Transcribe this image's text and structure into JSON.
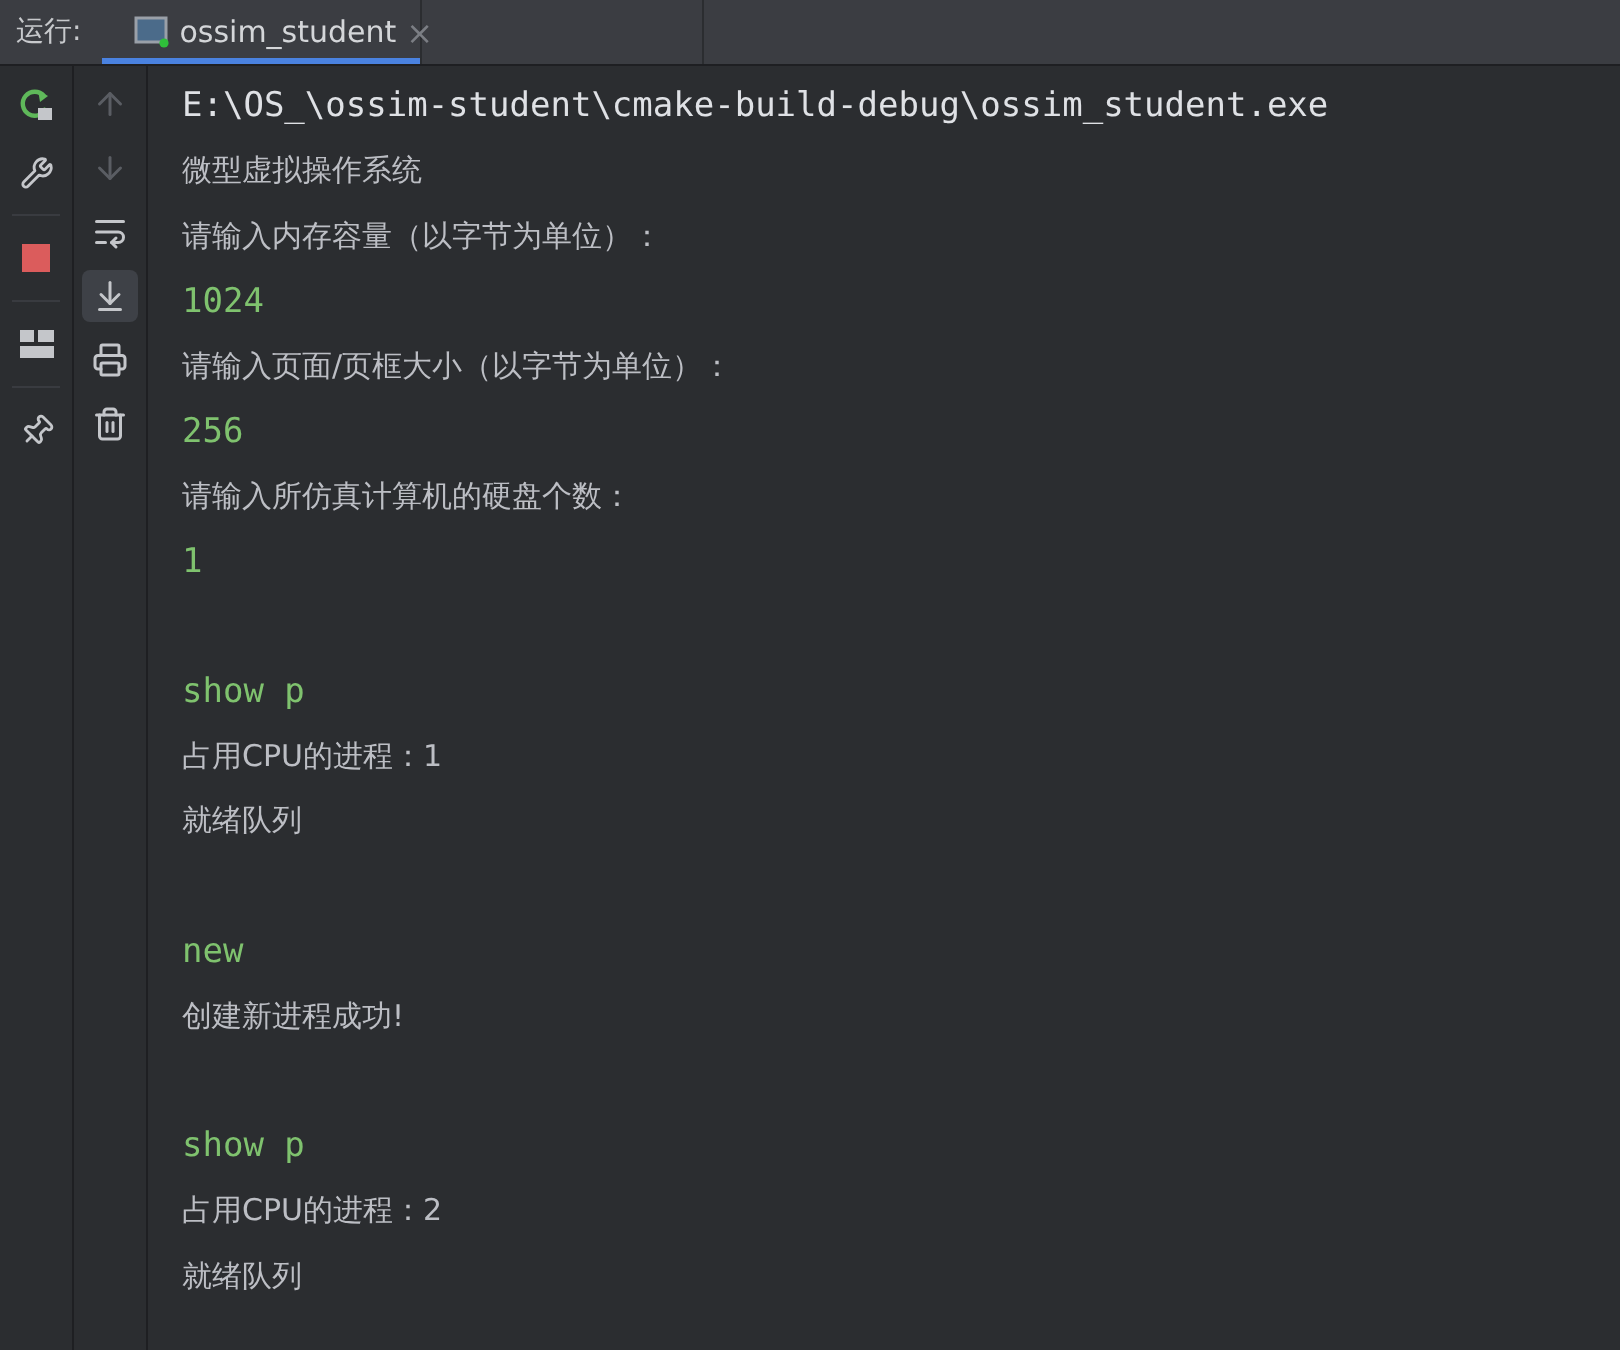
{
  "run_bar": {
    "label": "运行:",
    "tabs": [
      {
        "title": "ossim_student",
        "close": "×",
        "selected": true
      }
    ]
  },
  "left_toolbar": [
    {
      "kind": "rerun"
    },
    {
      "kind": "wrench"
    },
    {
      "kind": "stop"
    },
    {
      "kind": "layout"
    },
    {
      "kind": "pin"
    }
  ],
  "console_toolbar": [
    {
      "kind": "up",
      "disabled": true,
      "selected": false
    },
    {
      "kind": "down",
      "disabled": true,
      "selected": false
    },
    {
      "kind": "wrap",
      "disabled": false,
      "selected": false
    },
    {
      "kind": "scroll-end",
      "disabled": false,
      "selected": true
    },
    {
      "kind": "print",
      "disabled": false,
      "selected": false
    },
    {
      "kind": "trash",
      "disabled": false,
      "selected": false
    }
  ],
  "console_lines": [
    {
      "kind": "path",
      "text": "E:\\OS_\\ossim-student\\cmake-build-debug\\ossim_student.exe"
    },
    {
      "kind": "output",
      "text": "微型虚拟操作系统"
    },
    {
      "kind": "output",
      "text": "请输入内存容量（以字节为单位）："
    },
    {
      "kind": "input",
      "text": "1024"
    },
    {
      "kind": "output",
      "text": "请输入页面/页框大小（以字节为单位）："
    },
    {
      "kind": "input",
      "text": "256"
    },
    {
      "kind": "output",
      "text": "请输入所仿真计算机的硬盘个数："
    },
    {
      "kind": "input",
      "text": "1"
    },
    {
      "kind": "blank"
    },
    {
      "kind": "input",
      "text": "show p"
    },
    {
      "kind": "output",
      "text": "占用CPU的进程：1"
    },
    {
      "kind": "output",
      "text": "就绪队列"
    },
    {
      "kind": "blank"
    },
    {
      "kind": "input",
      "text": "new"
    },
    {
      "kind": "output",
      "text": "创建新进程成功!"
    },
    {
      "kind": "blank"
    },
    {
      "kind": "input",
      "text": "show p"
    },
    {
      "kind": "output",
      "text": "占用CPU的进程：2"
    },
    {
      "kind": "output",
      "text": "就绪队列"
    }
  ]
}
